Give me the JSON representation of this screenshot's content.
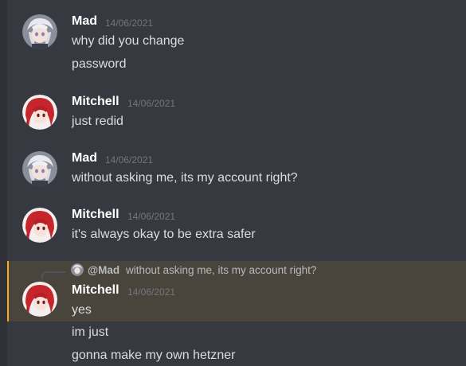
{
  "messages": [
    {
      "author": "Mad",
      "timestamp": "14/06/2021",
      "avatar": "mad-avatar",
      "lines": [
        "why did you change",
        "password"
      ]
    },
    {
      "author": "Mitchell",
      "timestamp": "14/06/2021",
      "avatar": "mitchell-avatar",
      "lines": [
        "just redid"
      ]
    },
    {
      "author": "Mad",
      "timestamp": "14/06/2021",
      "avatar": "mad-avatar",
      "lines": [
        "without asking me, its my account right?"
      ]
    },
    {
      "author": "Mitchell",
      "timestamp": "14/06/2021",
      "avatar": "mitchell-avatar",
      "lines": [
        "it's always okay to be extra safer"
      ]
    },
    {
      "author": "Mitchell",
      "timestamp": "14/06/2021",
      "avatar": "mitchell-avatar",
      "reply": {
        "mention": "@Mad",
        "text": "without asking me, its my account right?"
      },
      "lines": [
        "yes",
        "im just",
        "gonna make my own hetzner"
      ]
    }
  ],
  "colors": {
    "background": "#36393f",
    "highlight": "#49443c",
    "highlight_border": "#faa81a",
    "author": "#ffffff",
    "text": "#dcddde",
    "timestamp": "#72767d"
  }
}
